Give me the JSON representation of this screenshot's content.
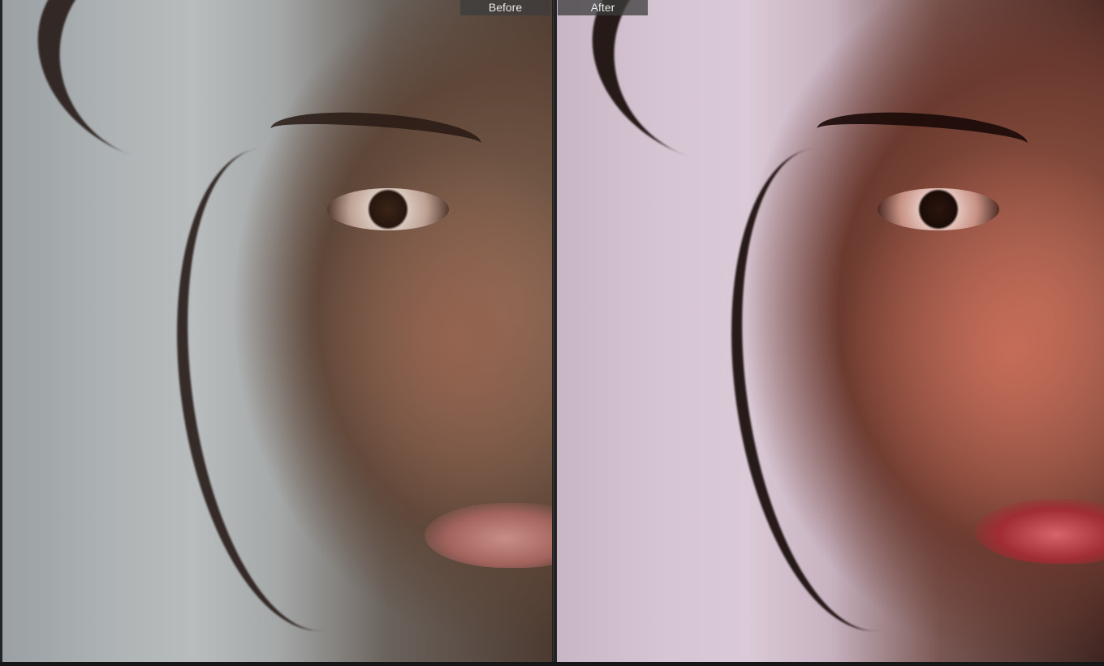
{
  "compare_view": {
    "before_label": "Before",
    "after_label": "After"
  },
  "colors": {
    "label_background": "#3c3c3c",
    "label_text": "#e8e8e8",
    "before_backdrop": "#b8bcbd",
    "after_backdrop": "#dac9d6"
  }
}
